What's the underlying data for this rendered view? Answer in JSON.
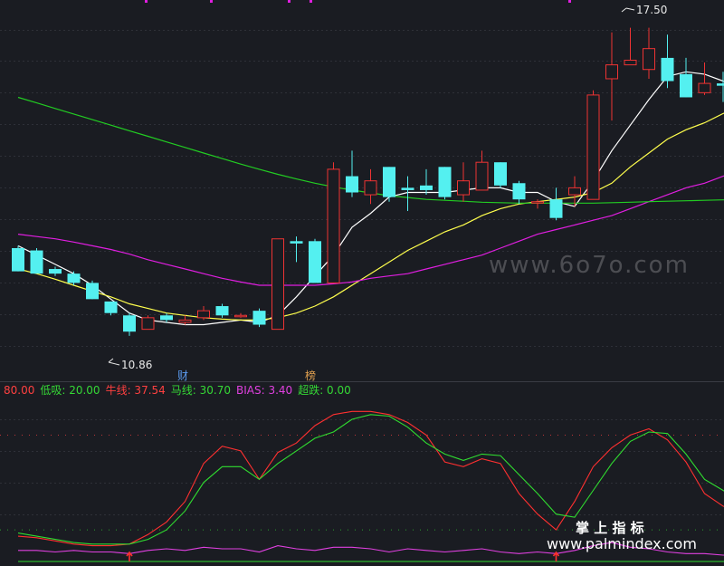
{
  "chart_data": [
    {
      "type": "candlestick",
      "price_range": [
        9.9,
        18.0
      ],
      "annotations": {
        "high_label": "17.50",
        "low_label": "10.86"
      },
      "event_marks": [
        {
          "label": "财",
          "color": "#5b9bf0"
        },
        {
          "label": "榜",
          "color": "#e0a050"
        }
      ],
      "candles": [
        {
          "o": 12.75,
          "h": 12.8,
          "l": 12.25,
          "c": 12.25
        },
        {
          "o": 12.7,
          "h": 12.75,
          "l": 12.2,
          "c": 12.2
        },
        {
          "o": 12.3,
          "h": 12.35,
          "l": 12.15,
          "c": 12.2
        },
        {
          "o": 12.2,
          "h": 12.25,
          "l": 11.95,
          "c": 12.0
        },
        {
          "o": 12.0,
          "h": 12.05,
          "l": 11.65,
          "c": 11.65
        },
        {
          "o": 11.6,
          "h": 11.6,
          "l": 11.3,
          "c": 11.35
        },
        {
          "o": 11.3,
          "h": 11.35,
          "l": 10.86,
          "c": 10.95
        },
        {
          "o": 11.0,
          "h": 11.3,
          "l": 11.0,
          "c": 11.25
        },
        {
          "o": 11.3,
          "h": 11.35,
          "l": 11.15,
          "c": 11.2
        },
        {
          "o": 11.15,
          "h": 11.3,
          "l": 11.1,
          "c": 11.2
        },
        {
          "o": 11.25,
          "h": 11.5,
          "l": 11.2,
          "c": 11.4
        },
        {
          "o": 11.5,
          "h": 11.55,
          "l": 11.25,
          "c": 11.3
        },
        {
          "o": 11.3,
          "h": 11.35,
          "l": 11.25,
          "c": 11.3
        },
        {
          "o": 11.4,
          "h": 11.45,
          "l": 11.05,
          "c": 11.1
        },
        {
          "o": 11.0,
          "h": 12.95,
          "l": 11.0,
          "c": 12.95
        },
        {
          "o": 12.9,
          "h": 13.0,
          "l": 12.45,
          "c": 12.85
        },
        {
          "o": 12.9,
          "h": 12.95,
          "l": 12.0,
          "c": 12.0
        },
        {
          "o": 12.0,
          "h": 14.6,
          "l": 12.0,
          "c": 14.45
        },
        {
          "o": 14.3,
          "h": 14.85,
          "l": 13.85,
          "c": 13.95
        },
        {
          "o": 13.9,
          "h": 14.45,
          "l": 13.7,
          "c": 14.2
        },
        {
          "o": 14.5,
          "h": 14.5,
          "l": 13.75,
          "c": 13.85
        },
        {
          "o": 14.05,
          "h": 14.3,
          "l": 13.55,
          "c": 14.0
        },
        {
          "o": 14.1,
          "h": 14.45,
          "l": 13.9,
          "c": 14.0
        },
        {
          "o": 14.5,
          "h": 14.5,
          "l": 13.8,
          "c": 13.85
        },
        {
          "o": 13.9,
          "h": 14.6,
          "l": 13.75,
          "c": 14.2
        },
        {
          "o": 14.0,
          "h": 14.85,
          "l": 14.0,
          "c": 14.6
        },
        {
          "o": 14.6,
          "h": 14.6,
          "l": 14.05,
          "c": 14.1
        },
        {
          "o": 14.15,
          "h": 14.2,
          "l": 13.7,
          "c": 13.8
        },
        {
          "o": 13.75,
          "h": 13.8,
          "l": 13.6,
          "c": 13.75
        },
        {
          "o": 13.8,
          "h": 14.05,
          "l": 13.35,
          "c": 13.4
        },
        {
          "o": 13.9,
          "h": 14.3,
          "l": 13.65,
          "c": 14.05
        },
        {
          "o": 13.8,
          "h": 16.15,
          "l": 13.8,
          "c": 16.05
        },
        {
          "o": 16.4,
          "h": 17.4,
          "l": 15.5,
          "c": 16.7
        },
        {
          "o": 16.7,
          "h": 17.5,
          "l": 16.7,
          "c": 16.8
        },
        {
          "o": 16.6,
          "h": 17.5,
          "l": 16.4,
          "c": 17.05
        },
        {
          "o": 16.85,
          "h": 17.35,
          "l": 16.2,
          "c": 16.35
        },
        {
          "o": 16.5,
          "h": 16.85,
          "l": 16.0,
          "c": 16.0
        },
        {
          "o": 16.1,
          "h": 16.75,
          "l": 16.05,
          "c": 16.3
        },
        {
          "o": 16.3,
          "h": 16.55,
          "l": 15.9,
          "c": 16.25
        },
        {
          "o": 16.2,
          "h": 16.55,
          "l": 15.95,
          "c": 16.25
        }
      ],
      "moving_averages": [
        {
          "color": "#ffffff",
          "values": [
            12.8,
            12.6,
            12.4,
            12.2,
            11.95,
            11.65,
            11.35,
            11.2,
            11.15,
            11.1,
            11.1,
            11.15,
            11.2,
            11.15,
            11.3,
            11.7,
            12.15,
            12.6,
            13.2,
            13.5,
            13.85,
            13.95,
            13.95,
            13.95,
            14.0,
            14.05,
            14.05,
            13.95,
            13.95,
            13.75,
            13.65,
            14.2,
            14.85,
            15.4,
            15.95,
            16.45,
            16.55,
            16.5,
            16.35,
            16.2
          ]
        },
        {
          "color": "#ffff4d",
          "values": [
            12.3,
            12.2,
            12.08,
            11.95,
            11.82,
            11.7,
            11.55,
            11.45,
            11.35,
            11.3,
            11.25,
            11.22,
            11.2,
            11.2,
            11.25,
            11.35,
            11.5,
            11.7,
            11.95,
            12.2,
            12.45,
            12.7,
            12.9,
            13.1,
            13.25,
            13.45,
            13.6,
            13.7,
            13.75,
            13.8,
            13.85,
            13.95,
            14.15,
            14.5,
            14.8,
            15.1,
            15.3,
            15.45,
            15.65,
            15.8
          ]
        },
        {
          "color": "#e01ee0",
          "values": [
            13.05,
            13.0,
            12.95,
            12.88,
            12.8,
            12.72,
            12.62,
            12.5,
            12.4,
            12.3,
            12.2,
            12.1,
            12.02,
            11.95,
            11.95,
            11.95,
            11.95,
            11.98,
            12.02,
            12.1,
            12.15,
            12.2,
            12.3,
            12.4,
            12.5,
            12.6,
            12.75,
            12.9,
            13.05,
            13.15,
            13.25,
            13.35,
            13.45,
            13.6,
            13.75,
            13.9,
            14.05,
            14.15,
            14.3,
            14.45
          ]
        },
        {
          "color": "#22cc22",
          "values": [
            16.0,
            15.88,
            15.76,
            15.64,
            15.52,
            15.4,
            15.28,
            15.16,
            15.04,
            14.92,
            14.8,
            14.68,
            14.56,
            14.45,
            14.34,
            14.24,
            14.15,
            14.07,
            14.0,
            13.94,
            13.88,
            13.84,
            13.8,
            13.78,
            13.76,
            13.74,
            13.73,
            13.72,
            13.72,
            13.72,
            13.72,
            13.72,
            13.73,
            13.74,
            13.75,
            13.76,
            13.77,
            13.78,
            13.79,
            13.8
          ]
        }
      ]
    },
    {
      "type": "line",
      "ylim": [
        0,
        100
      ],
      "legend": [
        {
          "text": "80.00",
          "color": "#ff4040"
        },
        {
          "text": "低吸: 20.00",
          "color": "#35d835"
        },
        {
          "text": "牛线: 37.54",
          "color": "#ff4040"
        },
        {
          "text": "马线: 30.70",
          "color": "#35d835"
        },
        {
          "text": "BIAS: 3.40",
          "color": "#e040e0"
        },
        {
          "text": "超跌: 0.00",
          "color": "#35d835"
        }
      ],
      "reference_lines": [
        {
          "value": 80,
          "color": "#ff4040"
        },
        {
          "value": 20,
          "color": "#35d835"
        }
      ],
      "signal_marks": [
        {
          "index": 6,
          "color": "#ff3030"
        },
        {
          "index": 29,
          "color": "#ff3030"
        }
      ],
      "series": [
        {
          "color": "#ff3030",
          "values": [
            16,
            15,
            13,
            11,
            10,
            10,
            11,
            17,
            25,
            38,
            62,
            73,
            70,
            52,
            69,
            75,
            86,
            93,
            95,
            95,
            93,
            88,
            80,
            63,
            60,
            65,
            62,
            43,
            30,
            20,
            38,
            60,
            72,
            80,
            84,
            77,
            63,
            43,
            35,
            30
          ]
        },
        {
          "color": "#30dd30",
          "values": [
            18,
            16,
            14,
            12,
            11,
            11,
            11,
            14,
            20,
            32,
            50,
            60,
            60,
            52,
            62,
            70,
            78,
            82,
            90,
            93,
            92,
            85,
            75,
            68,
            64,
            68,
            67,
            55,
            43,
            30,
            28,
            45,
            62,
            76,
            82,
            81,
            68,
            52,
            45,
            38
          ]
        },
        {
          "color": "#e040e0",
          "values": [
            7,
            7,
            6,
            7,
            6,
            6,
            5,
            7,
            8,
            7,
            9,
            8,
            8,
            6,
            10,
            8,
            7,
            9,
            9,
            8,
            6,
            8,
            7,
            6,
            7,
            8,
            6,
            5,
            6,
            5,
            7,
            10,
            12,
            9,
            8,
            6,
            5,
            5,
            4,
            4
          ]
        },
        {
          "color": "#30dd30",
          "values": [
            0,
            0,
            0,
            0,
            0,
            0,
            0,
            0,
            0,
            0,
            0,
            0,
            0,
            0,
            0,
            0,
            0,
            0,
            0,
            0,
            0,
            0,
            0,
            0,
            0,
            0,
            0,
            0,
            0,
            0,
            0,
            0,
            0,
            0,
            0,
            0,
            0,
            0,
            0,
            0
          ]
        }
      ]
    }
  ],
  "watermarks": {
    "top_url": "www.6o7o.com",
    "bottom_brand": "掌 上 指 标",
    "bottom_url": "www.palmindex.com"
  }
}
